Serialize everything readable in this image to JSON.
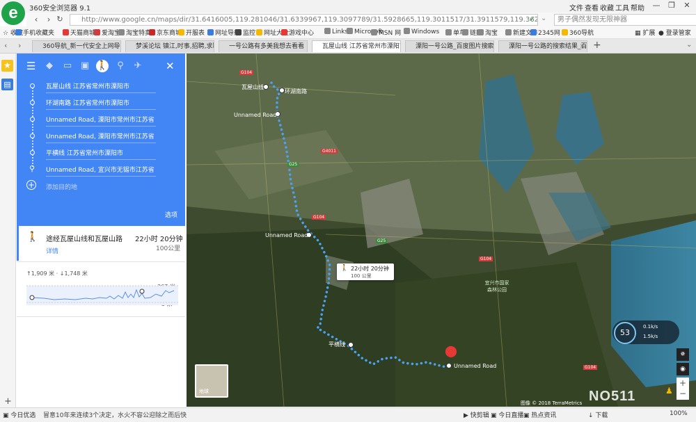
{
  "window": {
    "title": "360安全浏览器 9.1",
    "menu": [
      "文件",
      "查看",
      "收藏",
      "工具",
      "帮助"
    ],
    "controls": [
      "—",
      "❐",
      "✕"
    ]
  },
  "address": {
    "url": "http://www.google.cn/maps/dir/31.6416005,119.281046/31.6339967,119.3097789/31.5928665,119.3011517/31.3911579,119.3620915/31.2052994,...",
    "search_placeholder": "男子偶然发现无限神器"
  },
  "bookmarks": {
    "favorites_label": "收藏",
    "items": [
      "手机收藏夹",
      "天猫商城",
      "爱淘宝",
      "淘宝特卖",
      "京东商城",
      "开服表",
      "网址导航",
      "监控",
      "网址大全",
      "游戏中心",
      "Links",
      "Microsoft",
      "MSN 网",
      "Windows",
      "单车",
      "链接",
      "淘宝",
      "新建文件",
      "2345网",
      "360导航"
    ],
    "expand_label": "扩展",
    "login_label": "登录管家"
  },
  "tabs": [
    {
      "label": "360导航_新一代安全上网导航",
      "active": false
    },
    {
      "label": "梦溪论坛 镇江,时事,招聘,求职,生",
      "active": false
    },
    {
      "label": "一号公路有多美我想去看看（攀",
      "active": false
    },
    {
      "label": "瓦屋山线 江苏省常州市溧阳市至",
      "active": true
    },
    {
      "label": "溧阳一号公路_百度图片搜索",
      "active": false
    },
    {
      "label": "溧阳一号公路的搜索结果_百度图",
      "active": false
    }
  ],
  "directions": {
    "stops": [
      "瓦屋山线 江苏省常州市溧阳市",
      "环湖南路 江苏省常州市溧阳市",
      "Unnamed Road, 溧阳市常州市江苏省",
      "Unnamed Road, 溧阳市常州市江苏省",
      "平横线 江苏省常州市溧阳市",
      "Unnamed Road, 宜兴市无锡市江苏省"
    ],
    "add_destination": "添加目的地",
    "options_label": "选项",
    "route_via": "途经瓦屋山线和瓦屋山路",
    "duration": "22小时 20分钟",
    "details_label": "详情",
    "distance": "100公里",
    "elevation_summary": "↑1,909 米 · ↓1,748 米",
    "elevation_max": "367 米",
    "elevation_min": "3 米"
  },
  "map": {
    "labels": [
      {
        "name": "瓦屋山线"
      },
      {
        "name": "环湖南路"
      },
      {
        "name": "Unnamed Road"
      },
      {
        "name": "Unnamed Road"
      },
      {
        "name": "平横线"
      },
      {
        "name": "Unnamed Road"
      }
    ],
    "route_callout_duration": "22小时 20分钟",
    "route_callout_distance": "100 公里",
    "town_label": "宜兴市国家森林公园",
    "satellite_label": "地球",
    "copyright": "图像 © 2018 TerraMetrics",
    "road_badges": [
      "G104",
      "G4011",
      "G25",
      "G104",
      "G25",
      "G104",
      "G104"
    ],
    "speed_percent": "53",
    "speed_up": "0.1k/s",
    "speed_down": "1.5k/s",
    "watermark": "NO511",
    "route_color": "#4aa3f0"
  },
  "statusbar": {
    "left_label": "今日优选",
    "news": "冒意10年来连续3个决定，水火不容公迎除之而后快",
    "items": [
      "快剪辑",
      "今日直播",
      "热点资讯",
      "下载"
    ],
    "zoom": "100%"
  }
}
